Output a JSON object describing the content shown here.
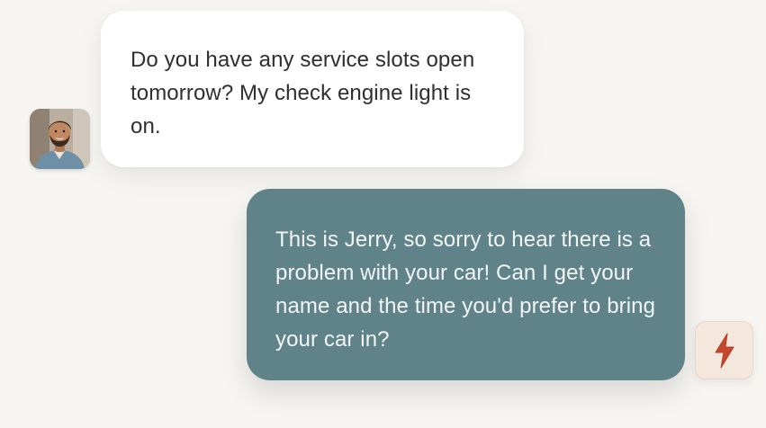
{
  "conversation": {
    "messages": [
      {
        "sender": "customer",
        "text": "Do you have any service slots open tomorrow? My check engine light is on."
      },
      {
        "sender": "agent",
        "text": "This is Jerry, so sorry to hear there is a problem with your car! Can I get your name and the time you'd prefer to bring your car in?"
      }
    ]
  },
  "icons": {
    "customer_avatar": "user-avatar-photo",
    "agent_badge": "lightning-bolt-icon"
  },
  "colors": {
    "background": "#f6f5f1",
    "incoming_bubble": "#ffffff",
    "incoming_text": "#2f2f2f",
    "outgoing_bubble": "#5f8388",
    "outgoing_text": "#f3f5f4",
    "agent_badge_bg": "#f4e8dc",
    "bolt": "#c4472c"
  }
}
